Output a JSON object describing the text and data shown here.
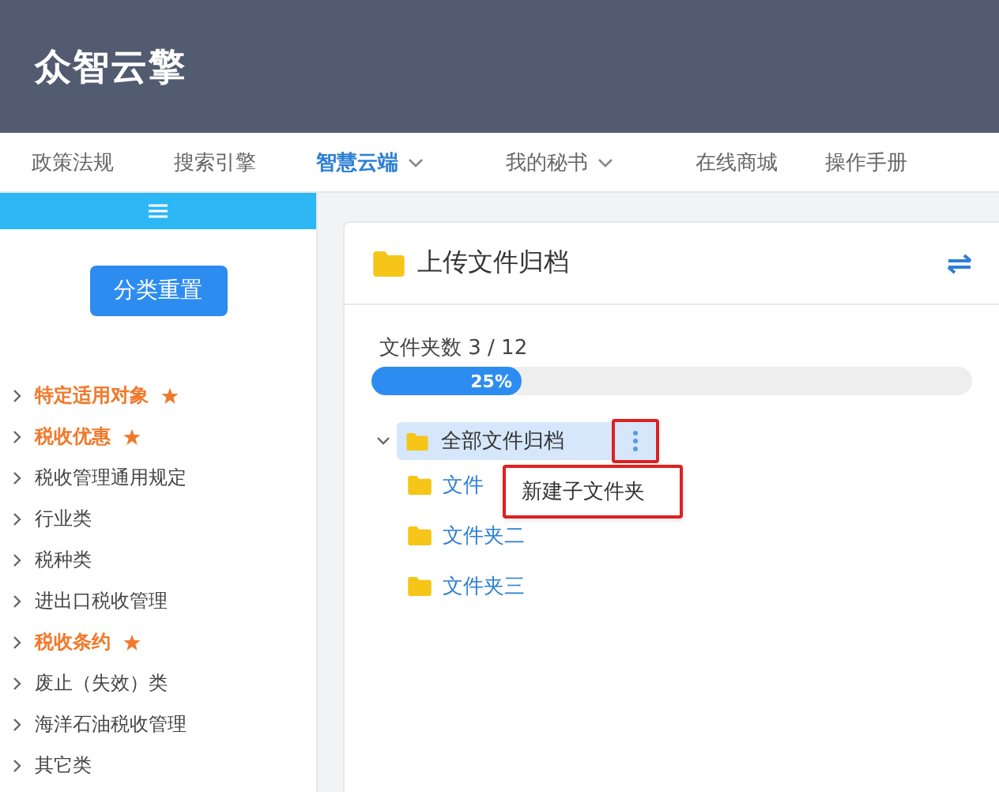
{
  "header": {
    "logo": "众智云擎"
  },
  "nav": [
    {
      "label": "政策法规",
      "selected": false,
      "dropdown": false
    },
    {
      "label": "搜索引擎",
      "selected": false,
      "dropdown": false
    },
    {
      "label": "智慧云端",
      "selected": true,
      "dropdown": true
    },
    {
      "label": "我的秘书",
      "selected": false,
      "dropdown": true
    },
    {
      "label": "在线商城",
      "selected": false,
      "dropdown": false
    },
    {
      "label": "操作手册",
      "selected": false,
      "dropdown": false
    }
  ],
  "sidebar": {
    "reset_button": "分类重置",
    "items": [
      {
        "label": "特定适用对象",
        "starred": true
      },
      {
        "label": "税收优惠",
        "starred": true
      },
      {
        "label": "税收管理通用规定",
        "starred": false
      },
      {
        "label": "行业类",
        "starred": false
      },
      {
        "label": "税种类",
        "starred": false
      },
      {
        "label": "进出口税收管理",
        "starred": false
      },
      {
        "label": "税收条约",
        "starred": true
      },
      {
        "label": "废止（失效）类",
        "starred": false
      },
      {
        "label": "海洋石油税收管理",
        "starred": false
      },
      {
        "label": "其它类",
        "starred": false
      }
    ]
  },
  "card": {
    "title": "上传文件归档",
    "count_label": "文件夹数 3 / 12",
    "progress": {
      "level": 0.25,
      "reading": "25%"
    },
    "tree": {
      "label": "全部文件归档",
      "expanded": true,
      "selected": true,
      "children": [
        {
          "label": "文件"
        },
        {
          "label": "文件夹二"
        },
        {
          "label": "文件夹三"
        }
      ]
    },
    "context_menu": {
      "items": [
        "新建子文件夹"
      ]
    }
  }
}
